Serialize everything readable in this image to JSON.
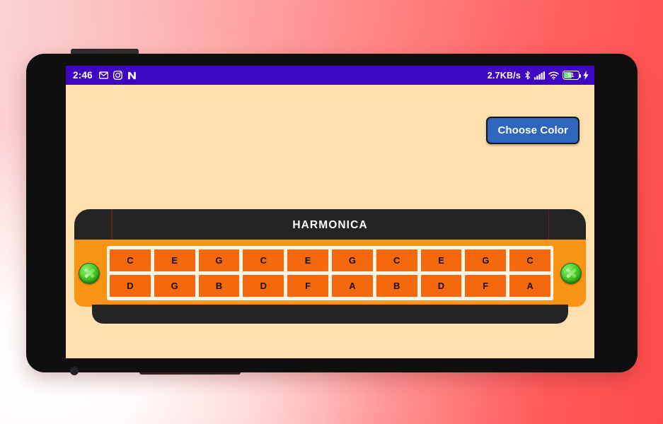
{
  "status_bar": {
    "clock": "2:46",
    "left_icons": [
      "gmail-icon",
      "instagram-icon",
      "n-app-icon"
    ],
    "network_speed": "2.7KB/s",
    "right_icons": [
      "bluetooth-icon",
      "signal-icon",
      "wifi-icon",
      "battery-icon",
      "charging-bolt-icon"
    ],
    "battery_level": "51",
    "background_color": "#3f06c2"
  },
  "app": {
    "background_color": "#fedfaf",
    "choose_color_label": "Choose Color",
    "choose_color_bg": "#2f65bd"
  },
  "harmonica": {
    "title": "HARMONICA",
    "plate_color": "#252425",
    "comb_color": "#f99414",
    "cell_color": "#f4690d",
    "left_screw": "screw-icon",
    "right_screw": "screw-icon",
    "blow_row": [
      "C",
      "E",
      "G",
      "C",
      "E",
      "G",
      "C",
      "E",
      "G",
      "C"
    ],
    "draw_row": [
      "D",
      "G",
      "B",
      "D",
      "F",
      "A",
      "B",
      "D",
      "F",
      "A"
    ]
  }
}
